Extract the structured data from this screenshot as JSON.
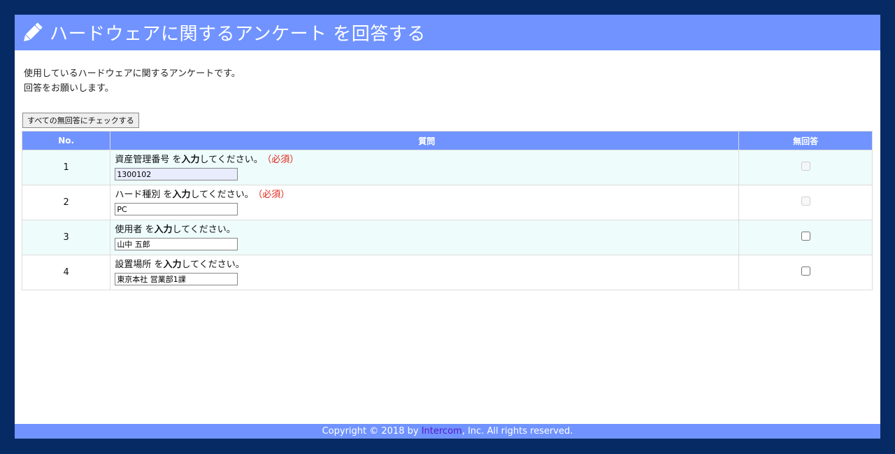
{
  "header": {
    "title": "ハードウェアに関するアンケート を回答する",
    "icon": "pencil-icon"
  },
  "intro": {
    "line1": "使用しているハードウェアに関するアンケートです。",
    "line2": "回答をお願いします。"
  },
  "check_all_label": "すべての無回答にチェックする",
  "table": {
    "headers": [
      "No.",
      "質問",
      "無回答"
    ],
    "input_prompt": "入力",
    "rows": [
      {
        "no": "1",
        "subject": "資産管理番号 を",
        "suffix": "してください。",
        "required": "（必須）",
        "value": "1300102",
        "no_answer_disabled": true
      },
      {
        "no": "2",
        "subject": "ハード種別 を",
        "suffix": "してください。",
        "required": "（必須）",
        "value": "PC",
        "no_answer_disabled": true
      },
      {
        "no": "3",
        "subject": "使用者 を",
        "suffix": "してください。",
        "required": "",
        "value": "山中 五郎",
        "no_answer_disabled": false
      },
      {
        "no": "4",
        "subject": "設置場所 を",
        "suffix": "してください。",
        "required": "",
        "value": "東京本社 営業部1課",
        "no_answer_disabled": false
      }
    ]
  },
  "footer": {
    "prefix": "Copyright © 2018 by ",
    "link": "Intercom",
    "suffix": ", Inc. All rights reserved."
  },
  "colors": {
    "background": "#062a63",
    "accent": "#7093ff",
    "required": "#e0261b",
    "row_alt": "#eefcfb"
  }
}
